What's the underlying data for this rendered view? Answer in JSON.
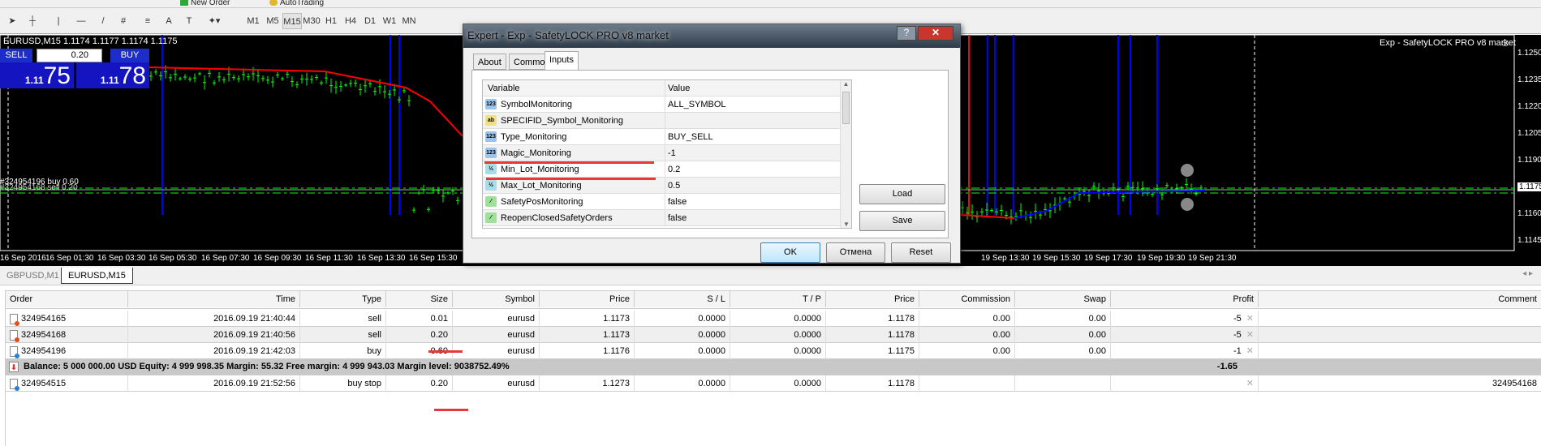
{
  "toolbar": {
    "timeframes": [
      "M1",
      "M5",
      "M15",
      "M30",
      "H1",
      "H4",
      "D1",
      "W1",
      "MN"
    ],
    "selected_timeframe": "M15",
    "new_order": "New Order",
    "auto_trading": "AutoTrading"
  },
  "chart": {
    "header": "EURUSD,M15  1.1174 1.1177 1.1174 1.1175",
    "expert_label": "Exp - SafetyLOCK PRO v8 market",
    "sell_label": "SELL",
    "buy_label": "BUY",
    "lot": "0.20",
    "sell_price_prefix": "1.11",
    "sell_price_big": "75",
    "buy_price_prefix": "1.11",
    "buy_price_big": "78",
    "order_label_1": "#324954196 buy 0.60",
    "order_label_2": "#324954168 sell 0.20",
    "price_labels": [
      "1.1250",
      "1.1235",
      "1.1220",
      "1.1205",
      "1.1190",
      "1.1175",
      "1.1160",
      "1.1145"
    ],
    "current_price": "1.1175",
    "time_labels_left": [
      "16 Sep 2016",
      "16 Sep 01:30",
      "16 Sep 03:30",
      "16 Sep 05:30",
      "16 Sep 07:30",
      "16 Sep 09:30",
      "16 Sep 11:30",
      "16 Sep 13:30",
      "16 Sep 15:30"
    ],
    "time_labels_right": [
      "19 Sep 13:30",
      "19 Sep 15:30",
      "19 Sep 17:30",
      "19 Sep 19:30",
      "19 Sep 21:30"
    ],
    "colors": {
      "bars": "#00ff00",
      "ma_down": "#ff0000",
      "ma_up": "#0000ff",
      "background": "#000000"
    }
  },
  "chart_tabs": [
    {
      "label": "GBPUSD,M1",
      "active": false
    },
    {
      "label": "EURUSD,M15",
      "active": true
    }
  ],
  "dialog": {
    "title": "Expert - Exp - SafetyLOCK PRO v8 market",
    "tabs": [
      "About",
      "Common",
      "Inputs"
    ],
    "active_tab": "Inputs",
    "columns": [
      "Variable",
      "Value"
    ],
    "inputs": [
      {
        "icon": "int",
        "name": "SymbolMonitoring",
        "value": "ALL_SYMBOL"
      },
      {
        "icon": "string",
        "name": "SPECIFID_Symbol_Monitoring",
        "value": ""
      },
      {
        "icon": "int",
        "name": "Type_Monitoring",
        "value": "BUY_SELL"
      },
      {
        "icon": "int",
        "name": "Magic_Monitoring",
        "value": "-1"
      },
      {
        "icon": "double",
        "name": "Min_Lot_Monitoring",
        "value": "0.2"
      },
      {
        "icon": "double",
        "name": "Max_Lot_Monitoring",
        "value": "0.5"
      },
      {
        "icon": "bool",
        "name": "SafetyPosMonitoring",
        "value": "false"
      },
      {
        "icon": "bool",
        "name": "ReopenClosedSafetyOrders",
        "value": "false"
      }
    ],
    "load": "Load",
    "save": "Save",
    "ok": "OK",
    "cancel": "Отмена",
    "reset": "Reset"
  },
  "orders": {
    "columns": [
      "Order",
      "Time",
      "Type",
      "Size",
      "Symbol",
      "Price",
      "S / L",
      "T / P",
      "Price",
      "Commission",
      "Swap",
      "Profit",
      "Comment"
    ],
    "rows": [
      [
        "324954165",
        "2016.09.19 21:40:44",
        "sell",
        "0.01",
        "eurusd",
        "1.1173",
        "0.0000",
        "0.0000",
        "1.1178",
        "0.00",
        "0.00",
        "-5",
        ""
      ],
      [
        "324954168",
        "2016.09.19 21:40:56",
        "sell",
        "0.20",
        "eurusd",
        "1.1173",
        "0.0000",
        "0.0000",
        "1.1178",
        "0.00",
        "0.00",
        "-5",
        ""
      ],
      [
        "324954196",
        "2016.09.19 21:42:03",
        "buy",
        "0.60",
        "eurusd",
        "1.1176",
        "0.0000",
        "0.0000",
        "1.1175",
        "0.00",
        "0.00",
        "-1",
        ""
      ]
    ],
    "summary": "Balance: 5 000 000.00 USD  Equity: 4 999 998.35  Margin: 55.32  Free margin: 4 999 943.03  Margin level: 9038752.49%",
    "summary_profit": "-1.65",
    "pending": [
      "324954515",
      "2016.09.19 21:52:56",
      "buy stop",
      "0.20",
      "eurusd",
      "1.1273",
      "0.0000",
      "0.0000",
      "1.1178",
      "",
      "",
      "",
      "324954168"
    ]
  }
}
